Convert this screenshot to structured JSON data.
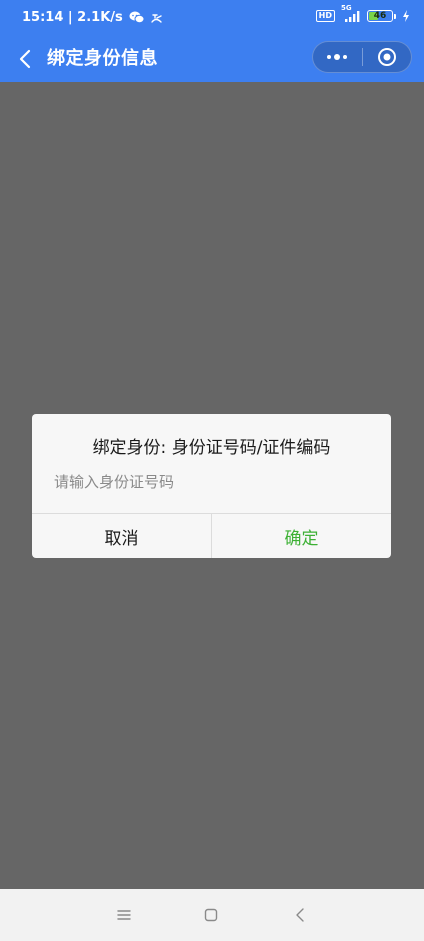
{
  "status_bar": {
    "time_speed": "15:14 | 2.1K/s",
    "hd_badge": "HD",
    "network": "5G",
    "battery_level": "46",
    "battery_fraction": 0.46,
    "icons": [
      "wechat-icon",
      "notification-icon",
      "signal-icon",
      "battery-icon",
      "charging-icon"
    ]
  },
  "nav": {
    "title": "绑定身份信息",
    "icons": [
      "back-icon",
      "more-icon",
      "close-target-icon"
    ]
  },
  "dialog": {
    "title": "绑定身份: 身份证号码/证件编码",
    "input_placeholder": "请输入身份证号码",
    "input_value": "",
    "cancel_label": "取消",
    "confirm_label": "确定"
  },
  "system_nav": {
    "icons": [
      "menu-icon",
      "home-icon",
      "back-nav-icon"
    ]
  },
  "colors": {
    "header": "#3d7ff0",
    "overlay": "#666666",
    "confirm": "#3cb034"
  }
}
